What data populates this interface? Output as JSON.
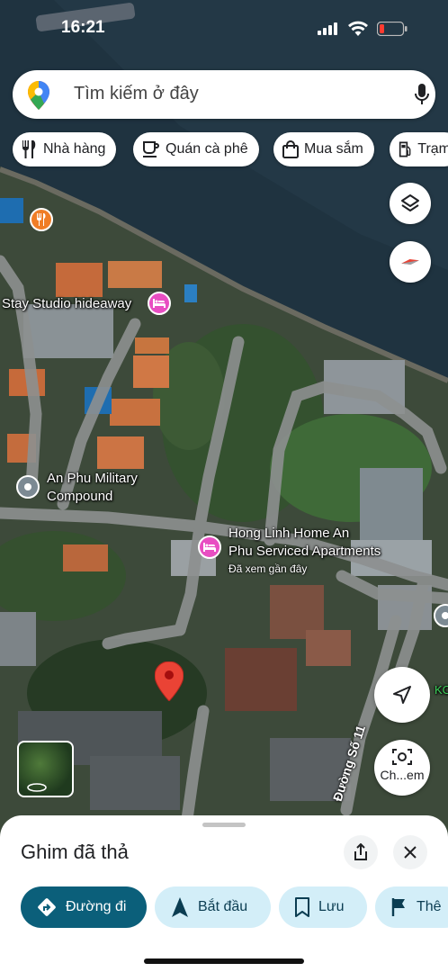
{
  "status_bar": {
    "time": "16:21"
  },
  "search": {
    "placeholder": "Tìm kiếm ở đây"
  },
  "chips": [
    {
      "label": "Nhà hàng",
      "icon": "fork-knife-icon"
    },
    {
      "label": "Quán cà phê",
      "icon": "coffee-icon"
    },
    {
      "label": "Mua sắm",
      "icon": "shopping-bag-icon"
    },
    {
      "label": "Trạm",
      "icon": "gas-station-icon"
    }
  ],
  "map": {
    "places": {
      "stay_studio": "Stay Studio hideaway",
      "an_phu_line1": "An Phu Military",
      "an_phu_line2": "Compound",
      "hong_linh_line1": "Hong Linh Home An",
      "hong_linh_line2": "Phu Serviced Apartments",
      "hong_linh_note": "Đã xem gần đây",
      "partial_label": "KC"
    },
    "road": "Đường Số 11",
    "street_view_label": "Ch...em"
  },
  "sheet": {
    "title": "Ghim đã thả",
    "actions": [
      {
        "label": "Đường đi",
        "icon": "directions-icon"
      },
      {
        "label": "Bắt đầu",
        "icon": "navigation-arrow-icon"
      },
      {
        "label": "Lưu",
        "icon": "bookmark-icon"
      },
      {
        "label": "Thê",
        "icon": "flag-icon"
      }
    ]
  },
  "colors": {
    "primary": "#0b57d0",
    "primary_dark": "#0b5f7a",
    "chip_action_bg": "#d3eef8",
    "pin_red": "#ea4335",
    "hotel_pink": "#e84ec2",
    "restaurant_orange": "#f07d26"
  }
}
